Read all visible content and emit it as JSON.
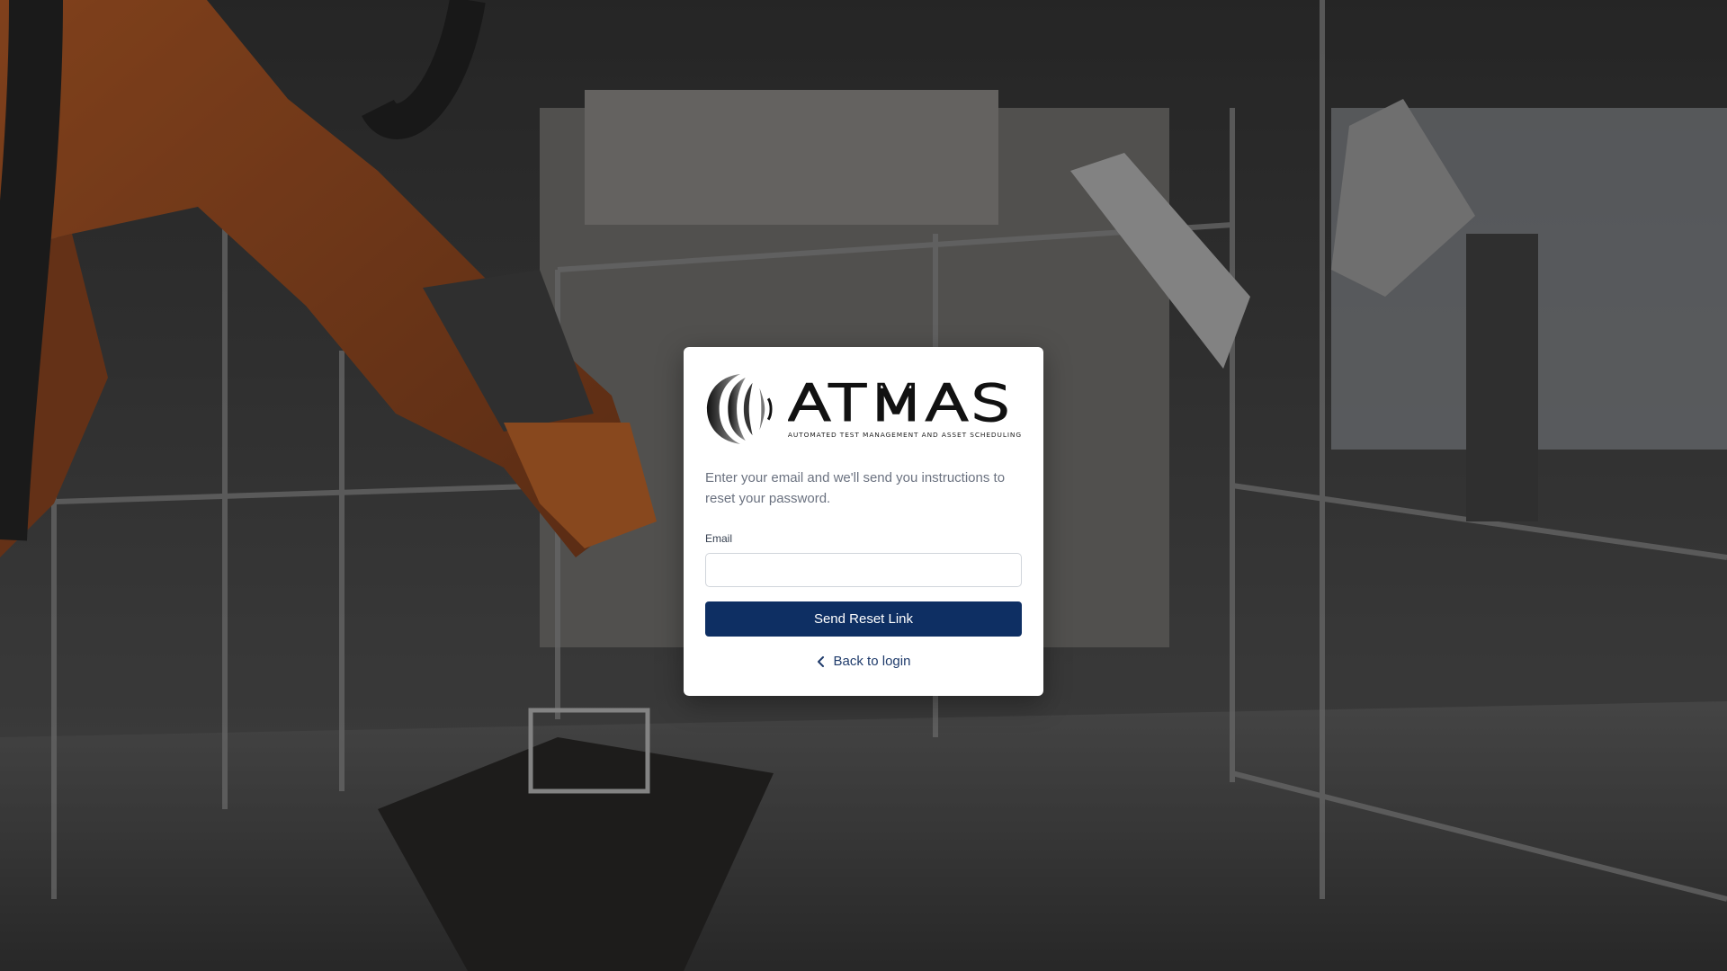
{
  "background": {
    "description_icon": "lab-robot-photo"
  },
  "brand": {
    "name": "ATMAS",
    "tagline": "AUTOMATED TEST MANAGEMENT AND ASSET SCHEDULING",
    "logo_icon": "atmas-logo-icon"
  },
  "reset_form": {
    "instructions": "Enter your email and we'll send you instructions to reset your password.",
    "email_label": "Email",
    "email_value": "",
    "email_placeholder": "",
    "submit_label": "Send Reset Link",
    "back_label": "Back to login",
    "back_icon": "chevron-left-icon"
  },
  "colors": {
    "primary_button": "#0e2f63",
    "link": "#1f3b6b",
    "muted_text": "#6b7280"
  }
}
